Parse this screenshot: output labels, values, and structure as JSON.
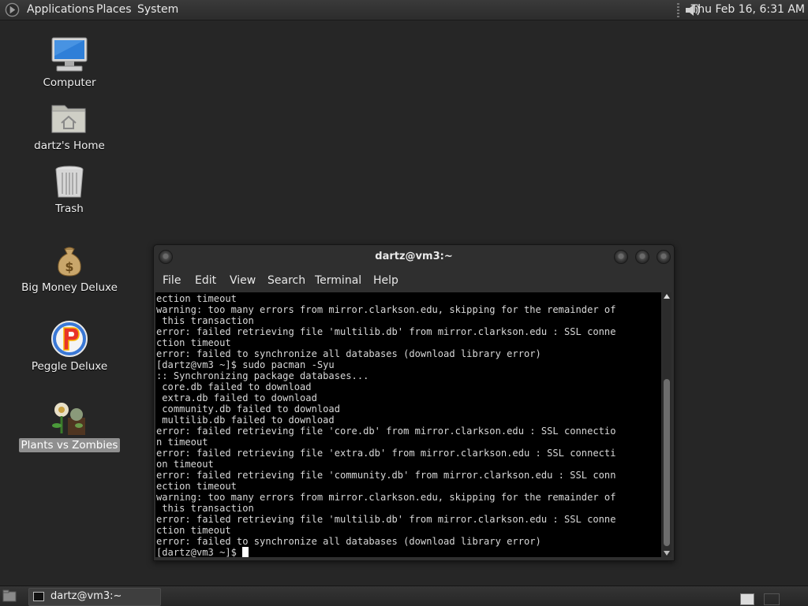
{
  "top_panel": {
    "menus": [
      "Applications",
      "Places",
      "System"
    ],
    "clock": "Thu Feb 16,  6:31 AM"
  },
  "desktop": {
    "icons": [
      {
        "label": "Computer",
        "icon": "computer-icon",
        "selected": false
      },
      {
        "label": "dartz's Home",
        "icon": "home-folder-icon",
        "selected": false
      },
      {
        "label": "Trash",
        "icon": "trash-icon",
        "selected": false
      },
      {
        "label": "Big Money Deluxe",
        "icon": "money-bag-icon",
        "selected": false
      },
      {
        "label": "Peggle Deluxe",
        "icon": "peggle-icon",
        "selected": false
      },
      {
        "label": "Plants vs Zombies",
        "icon": "plants-vs-zombies-icon",
        "selected": true
      }
    ]
  },
  "terminal": {
    "title": "dartz@vm3:~",
    "menu": [
      "File",
      "Edit",
      "View",
      "Search",
      "Terminal",
      "Help"
    ],
    "lines": [
      "ection timeout",
      "warning: too many errors from mirror.clarkson.edu, skipping for the remainder of",
      " this transaction",
      "error: failed retrieving file 'multilib.db' from mirror.clarkson.edu : SSL conne",
      "ction timeout",
      "error: failed to synchronize all databases (download library error)",
      "[dartz@vm3 ~]$ sudo pacman -Syu",
      ":: Synchronizing package databases...",
      " core.db failed to download",
      " extra.db failed to download",
      " community.db failed to download",
      " multilib.db failed to download",
      "error: failed retrieving file 'core.db' from mirror.clarkson.edu : SSL connectio",
      "n timeout",
      "error: failed retrieving file 'extra.db' from mirror.clarkson.edu : SSL connecti",
      "on timeout",
      "error: failed retrieving file 'community.db' from mirror.clarkson.edu : SSL conn",
      "ection timeout",
      "warning: too many errors from mirror.clarkson.edu, skipping for the remainder of",
      " this transaction",
      "error: failed retrieving file 'multilib.db' from mirror.clarkson.edu : SSL conne",
      "ction timeout",
      "error: failed to synchronize all databases (download library error)"
    ],
    "prompt": "[dartz@vm3 ~]$ "
  },
  "bottom_panel": {
    "task_label": "dartz@vm3:~"
  },
  "colors": {
    "desktop_bg": "#262626",
    "terminal_bg": "#000000",
    "terminal_fg": "#d8d8d8",
    "selected_label_bg": "#8f8f8f"
  }
}
